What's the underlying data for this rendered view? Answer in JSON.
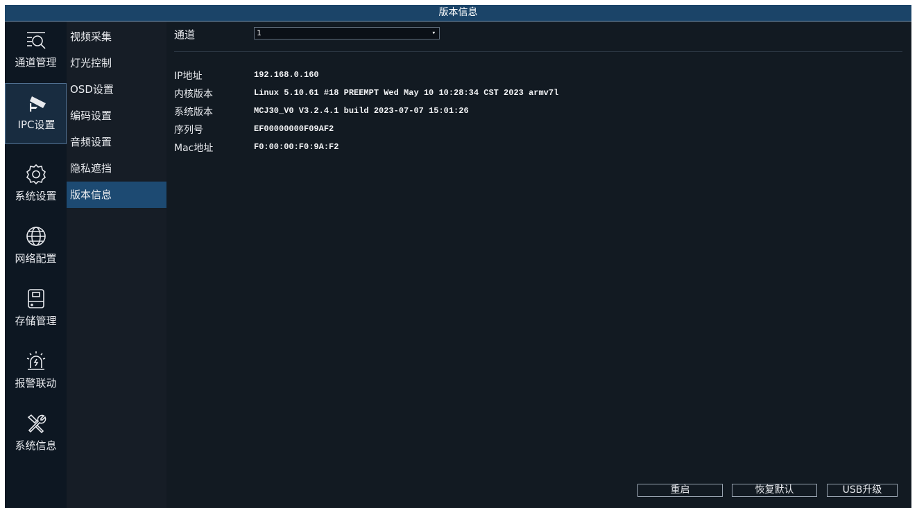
{
  "window": {
    "title": "版本信息"
  },
  "rail": [
    {
      "label": "通道管理",
      "icon": "channel-search-icon"
    },
    {
      "label": "IPC设置",
      "icon": "camera-icon"
    },
    {
      "label": "系统设置",
      "icon": "gear-icon"
    },
    {
      "label": "网络配置",
      "icon": "globe-icon"
    },
    {
      "label": "存储管理",
      "icon": "disk-icon"
    },
    {
      "label": "报警联动",
      "icon": "alarm-icon"
    },
    {
      "label": "系统信息",
      "icon": "tools-icon"
    }
  ],
  "submenu": [
    "视频采集",
    "灯光控制",
    "OSD设置",
    "编码设置",
    "音频设置",
    "隐私遮挡",
    "版本信息"
  ],
  "channel": {
    "label": "通道",
    "value": "1"
  },
  "info": [
    {
      "key": "IP地址",
      "value": "192.168.0.160"
    },
    {
      "key": "内核版本",
      "value": "Linux 5.10.61 #18 PREEMPT Wed May 10 10:28:34 CST 2023 armv7l"
    },
    {
      "key": "系统版本",
      "value": "MCJ30_V0 V3.2.4.1 build 2023-07-07 15:01:26"
    },
    {
      "key": "序列号",
      "value": "EF00000000F09AF2"
    },
    {
      "key": "Mac地址",
      "value": "F0:00:00:F0:9A:F2"
    }
  ],
  "buttons": {
    "reboot": "重启",
    "restore": "恢复默认",
    "usb_upgrade": "USB升级"
  },
  "colors": {
    "titlebar": "#1b4468",
    "active_submenu": "#1d4a72",
    "background": "#121a22"
  }
}
